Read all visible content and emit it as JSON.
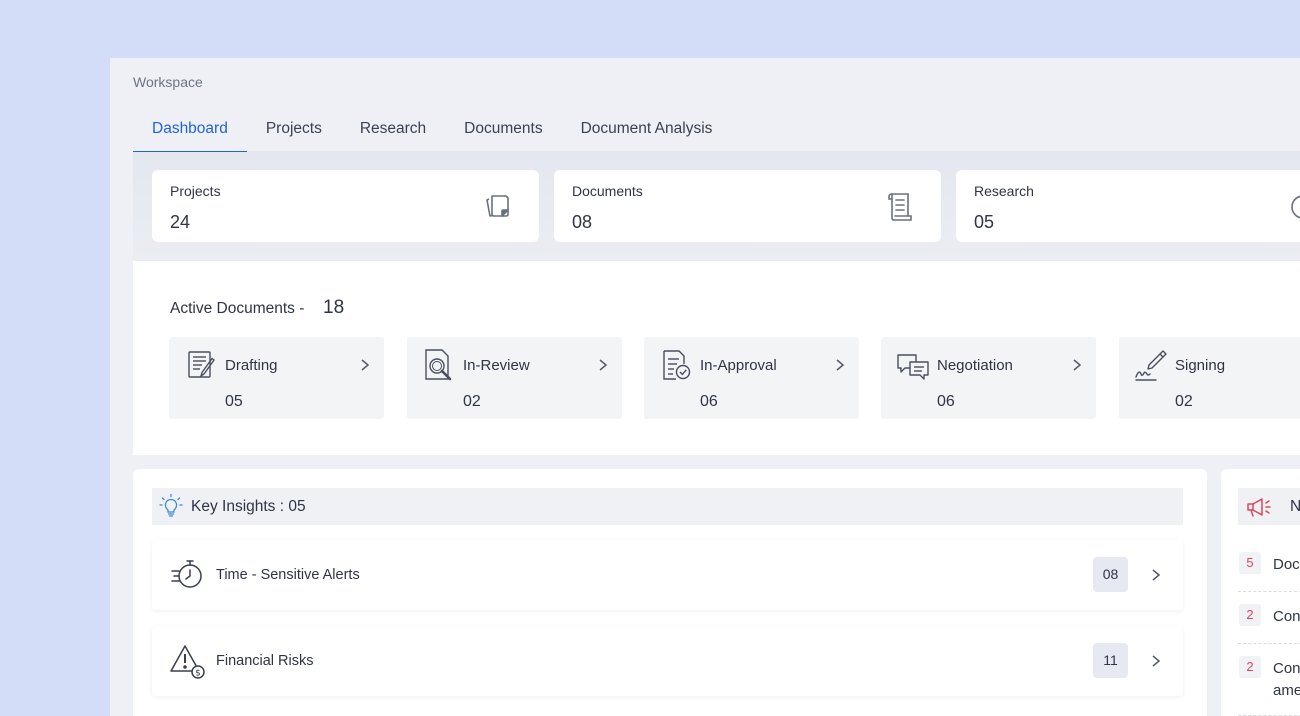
{
  "workspace": {
    "title": "Workspace"
  },
  "tabs": [
    {
      "label": "Dashboard",
      "active": true
    },
    {
      "label": "Projects",
      "active": false
    },
    {
      "label": "Research",
      "active": false
    },
    {
      "label": "Documents",
      "active": false
    },
    {
      "label": "Document Analysis",
      "active": false
    }
  ],
  "stats": [
    {
      "label": "Projects",
      "value": "24",
      "icon": "copy-icon"
    },
    {
      "label": "Documents",
      "value": "08",
      "icon": "document-icon"
    },
    {
      "label": "Research",
      "value": "05",
      "icon": "clock-icon"
    }
  ],
  "active_documents": {
    "title": "Active Documents -",
    "count": "18",
    "stages": [
      {
        "label": "Drafting",
        "value": "05",
        "icon": "drafting-icon"
      },
      {
        "label": "In-Review",
        "value": "02",
        "icon": "review-magnifier-icon"
      },
      {
        "label": "In-Approval",
        "value": "06",
        "icon": "approval-icon"
      },
      {
        "label": "Negotiation",
        "value": "06",
        "icon": "chat-bubbles-icon"
      },
      {
        "label": "Signing",
        "value": "02",
        "icon": "pen-signature-icon"
      }
    ]
  },
  "insights": {
    "title": "Key Insights : 05",
    "items": [
      {
        "label": "Time - Sensitive Alerts",
        "count": "08",
        "icon": "stopwatch-icon"
      },
      {
        "label": "Financial Risks",
        "count": "11",
        "icon": "warning-dollar-icon"
      }
    ]
  },
  "notifications": {
    "title": "N",
    "items": [
      {
        "badge": "5",
        "text": "Doc"
      },
      {
        "badge": "2",
        "text": "Con"
      },
      {
        "badge": "2",
        "text": "Con",
        "text2": "ame"
      }
    ]
  },
  "colors": {
    "accent": "#2164d8",
    "alert": "#e1455a",
    "background": "#d3ddf7"
  }
}
